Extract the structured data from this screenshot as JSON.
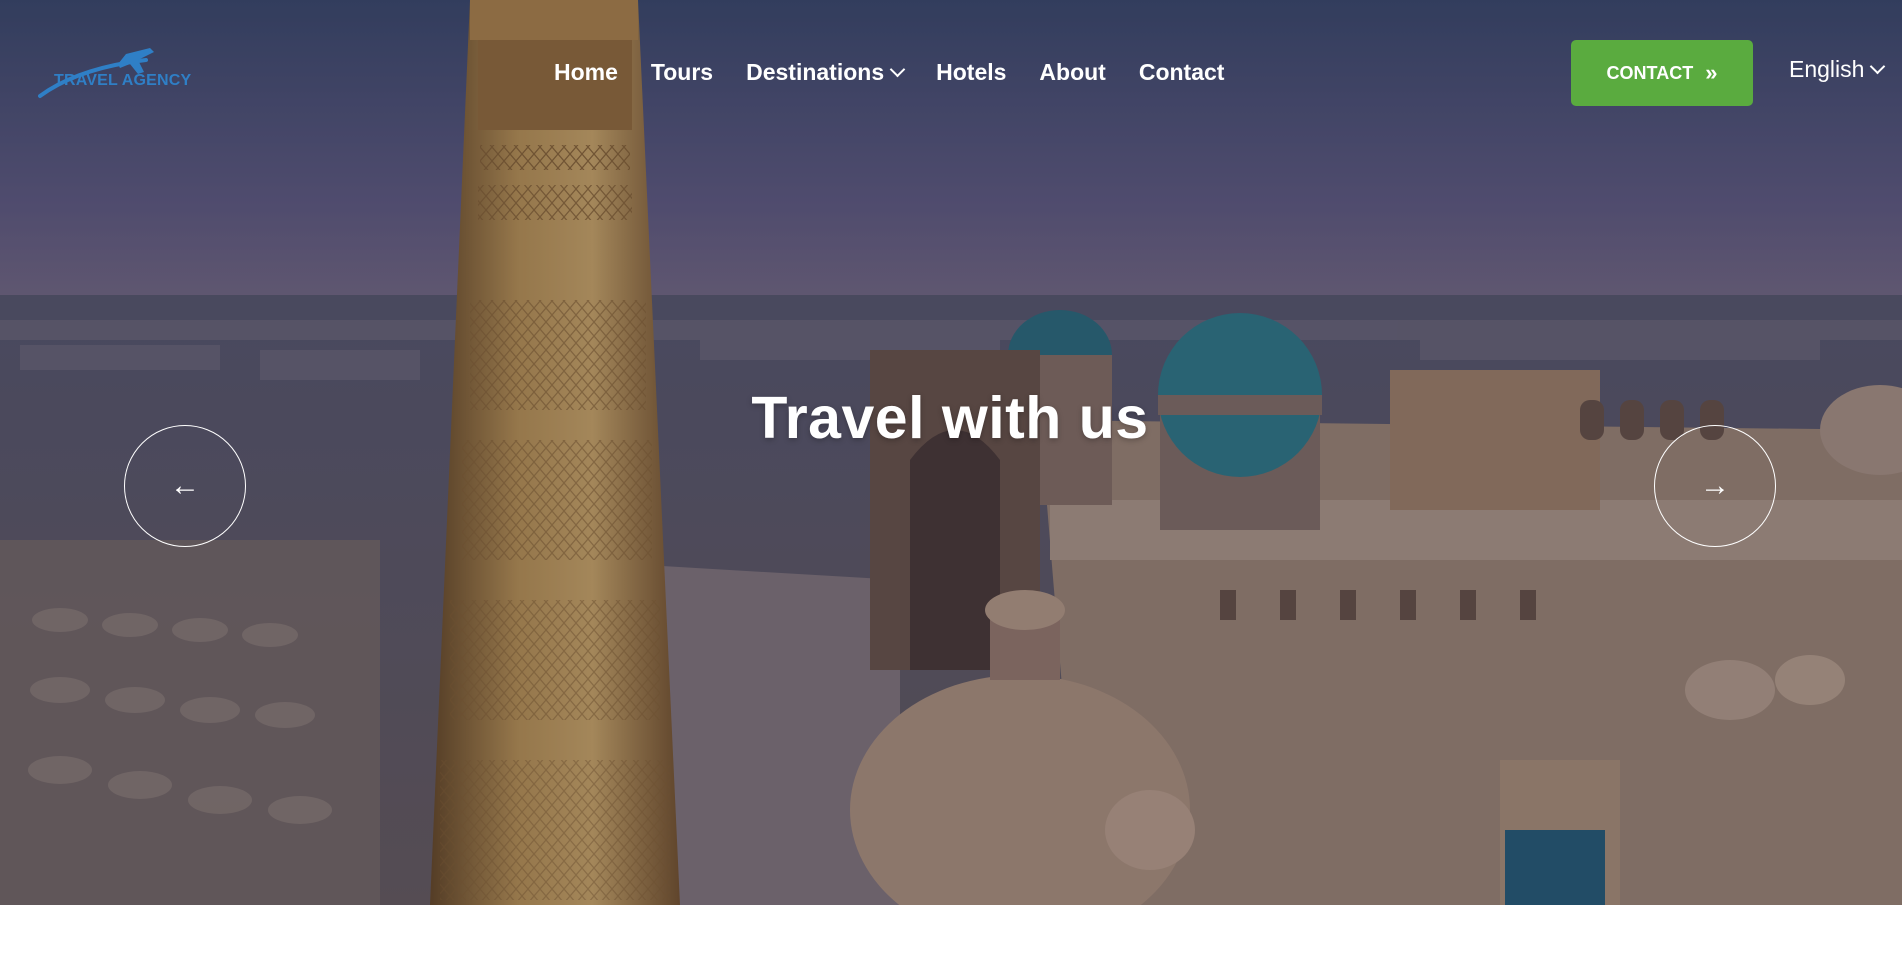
{
  "header": {
    "logo_text": "TRAVEL AGENCY",
    "nav": [
      {
        "label": "Home"
      },
      {
        "label": "Tours"
      },
      {
        "label": "Destinations",
        "has_dropdown": true
      },
      {
        "label": "Hotels"
      },
      {
        "label": "About"
      },
      {
        "label": "Contact"
      }
    ],
    "contact_button": {
      "label": "CONTACT",
      "icon": "double-chevron-right-icon"
    },
    "language": {
      "selected": "English"
    }
  },
  "hero": {
    "title": "Travel with us",
    "prev_icon": "arrow-left-icon",
    "next_icon": "arrow-right-icon"
  },
  "colors": {
    "accent_green": "#5aab3f",
    "logo_blue": "#2f7fc6",
    "text_white": "#ffffff"
  }
}
